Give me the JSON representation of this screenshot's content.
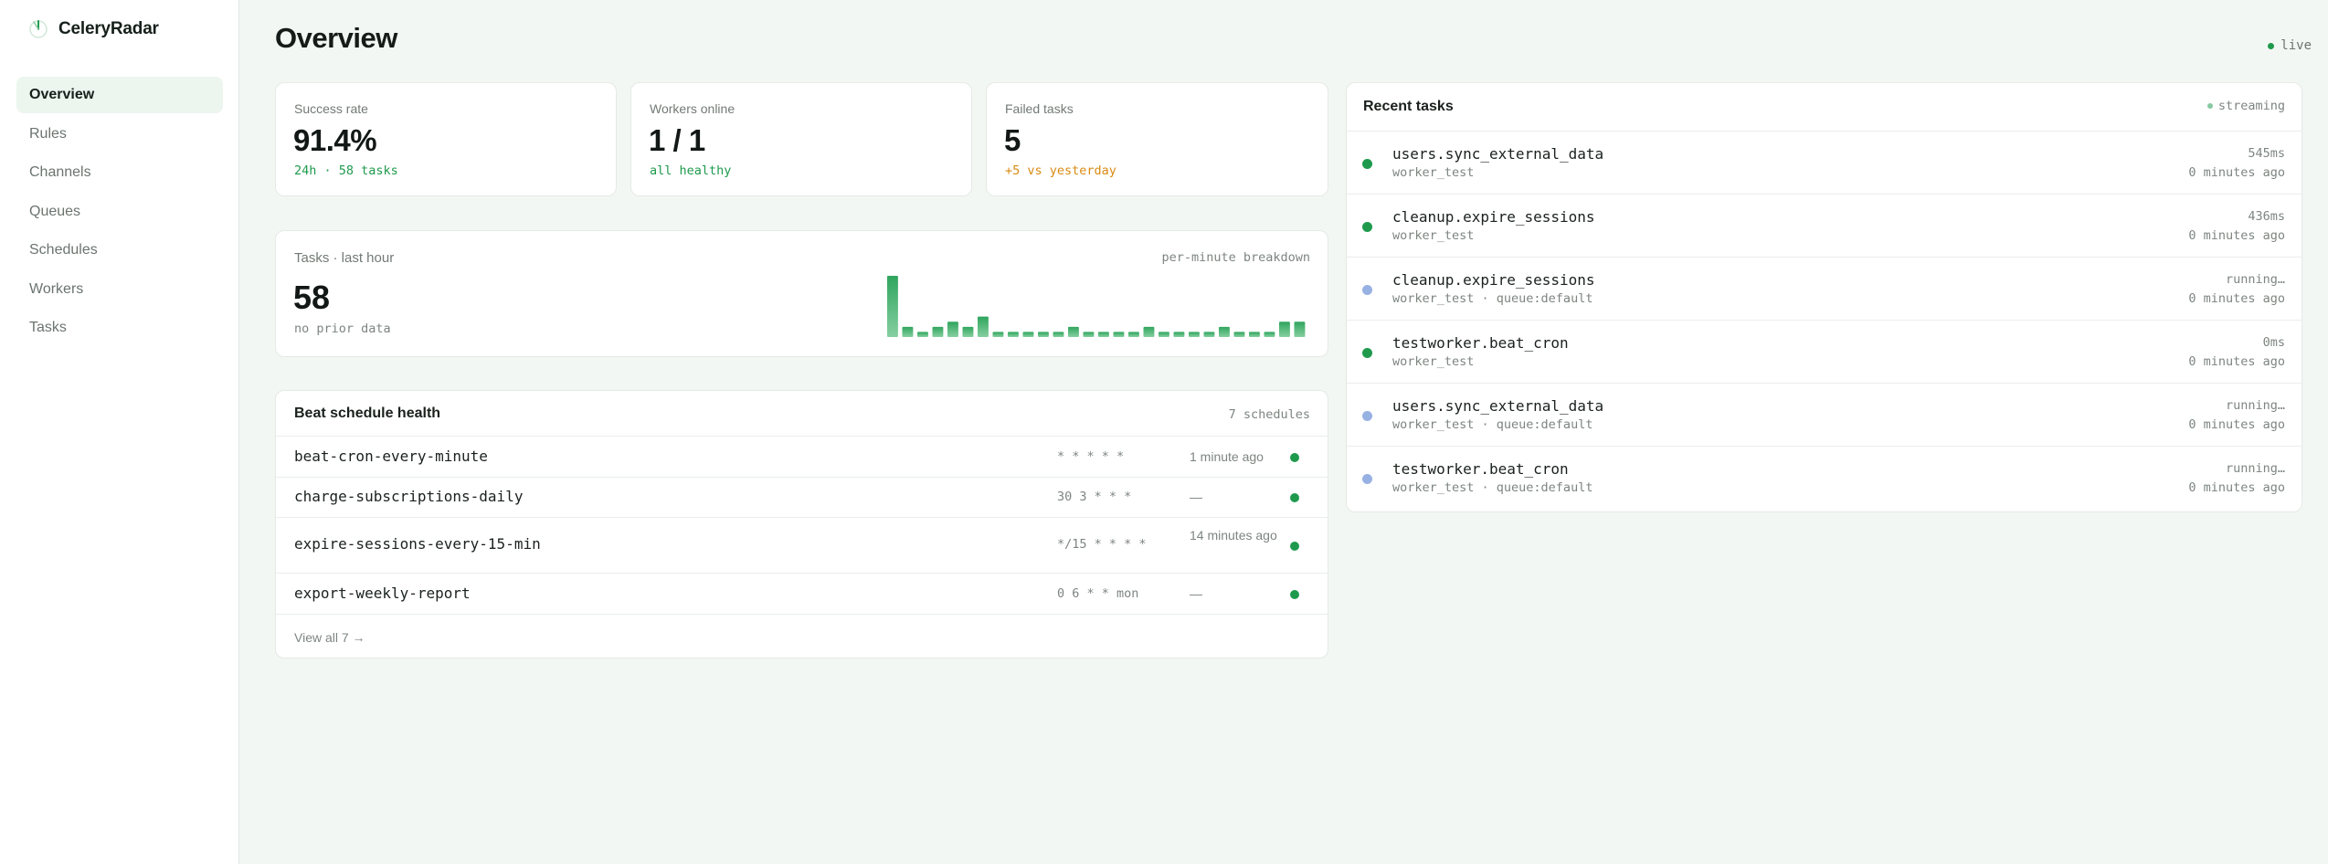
{
  "app": {
    "name": "CeleryRadar",
    "logo_icon": "radar-logo-icon"
  },
  "nav": {
    "items": [
      {
        "label": "Overview",
        "active": true
      },
      {
        "label": "Rules"
      },
      {
        "label": "Channels"
      },
      {
        "label": "Queues"
      },
      {
        "label": "Schedules"
      },
      {
        "label": "Workers"
      },
      {
        "label": "Tasks"
      }
    ]
  },
  "header": {
    "title": "Overview",
    "status": "live",
    "status_color": "#1f9a4d"
  },
  "stats": [
    {
      "label": "Success rate",
      "value": "91.4%",
      "sub": "24h · 58 tasks",
      "sub_color": "#1f9a4d"
    },
    {
      "label": "Workers online",
      "value": "1 / 1",
      "sub": "all healthy",
      "sub_color": "#1f9a4d"
    },
    {
      "label": "Failed tasks",
      "value": "5",
      "sub": "+5 vs yesterday",
      "sub_color": "#d98b12"
    }
  ],
  "tasks_hour": {
    "label": "Tasks · last hour",
    "value": "58",
    "sub": "no prior data",
    "breakdown_label": "per-minute breakdown"
  },
  "chart_data": {
    "type": "bar",
    "values": [
      12,
      2,
      1,
      2,
      3,
      2,
      4,
      1,
      1,
      1,
      1,
      1,
      2,
      1,
      1,
      1,
      1,
      2,
      1,
      1,
      1,
      1,
      2,
      1,
      1,
      1,
      3,
      3
    ],
    "color": "#2fa55d"
  },
  "beat": {
    "title": "Beat schedule health",
    "count": "7 schedules",
    "rows": [
      {
        "name": "beat-cron-every-minute",
        "cron": "* * * * *",
        "last": "1 minute ago",
        "status_color": "#1f9a4d"
      },
      {
        "name": "charge-subscriptions-daily",
        "cron": "30 3 * * *",
        "last": "—",
        "status_color": "#1f9a4d"
      },
      {
        "name": "expire-sessions-every-15-min",
        "cron": "*/15 * * * *",
        "last": "14 minutes ago",
        "status_color": "#1f9a4d"
      },
      {
        "name": "export-weekly-report",
        "cron": "0 6 * * mon",
        "last": "—",
        "status_color": "#1f9a4d"
      }
    ],
    "footer": "View all 7 →"
  },
  "recent": {
    "title": "Recent tasks",
    "status": "streaming",
    "rows": [
      {
        "name": "users.sync_external_data",
        "meta": "worker_test",
        "duration": "545ms",
        "ago": "0 minutes ago",
        "status_color": "#1f9a4d"
      },
      {
        "name": "cleanup.expire_sessions",
        "meta": "worker_test",
        "duration": "436ms",
        "ago": "0 minutes ago",
        "status_color": "#1f9a4d"
      },
      {
        "name": "cleanup.expire_sessions",
        "meta": "worker_test · queue:default",
        "duration": "running…",
        "ago": "0 minutes ago",
        "status_color": "#98b1e3"
      },
      {
        "name": "testworker.beat_cron",
        "meta": "worker_test",
        "duration": "0ms",
        "ago": "0 minutes ago",
        "status_color": "#1f9a4d"
      },
      {
        "name": "users.sync_external_data",
        "meta": "worker_test · queue:default",
        "duration": "running…",
        "ago": "0 minutes ago",
        "status_color": "#98b1e3"
      },
      {
        "name": "testworker.beat_cron",
        "meta": "worker_test · queue:default",
        "duration": "running…",
        "ago": "0 minutes ago",
        "status_color": "#98b1e3"
      }
    ]
  }
}
